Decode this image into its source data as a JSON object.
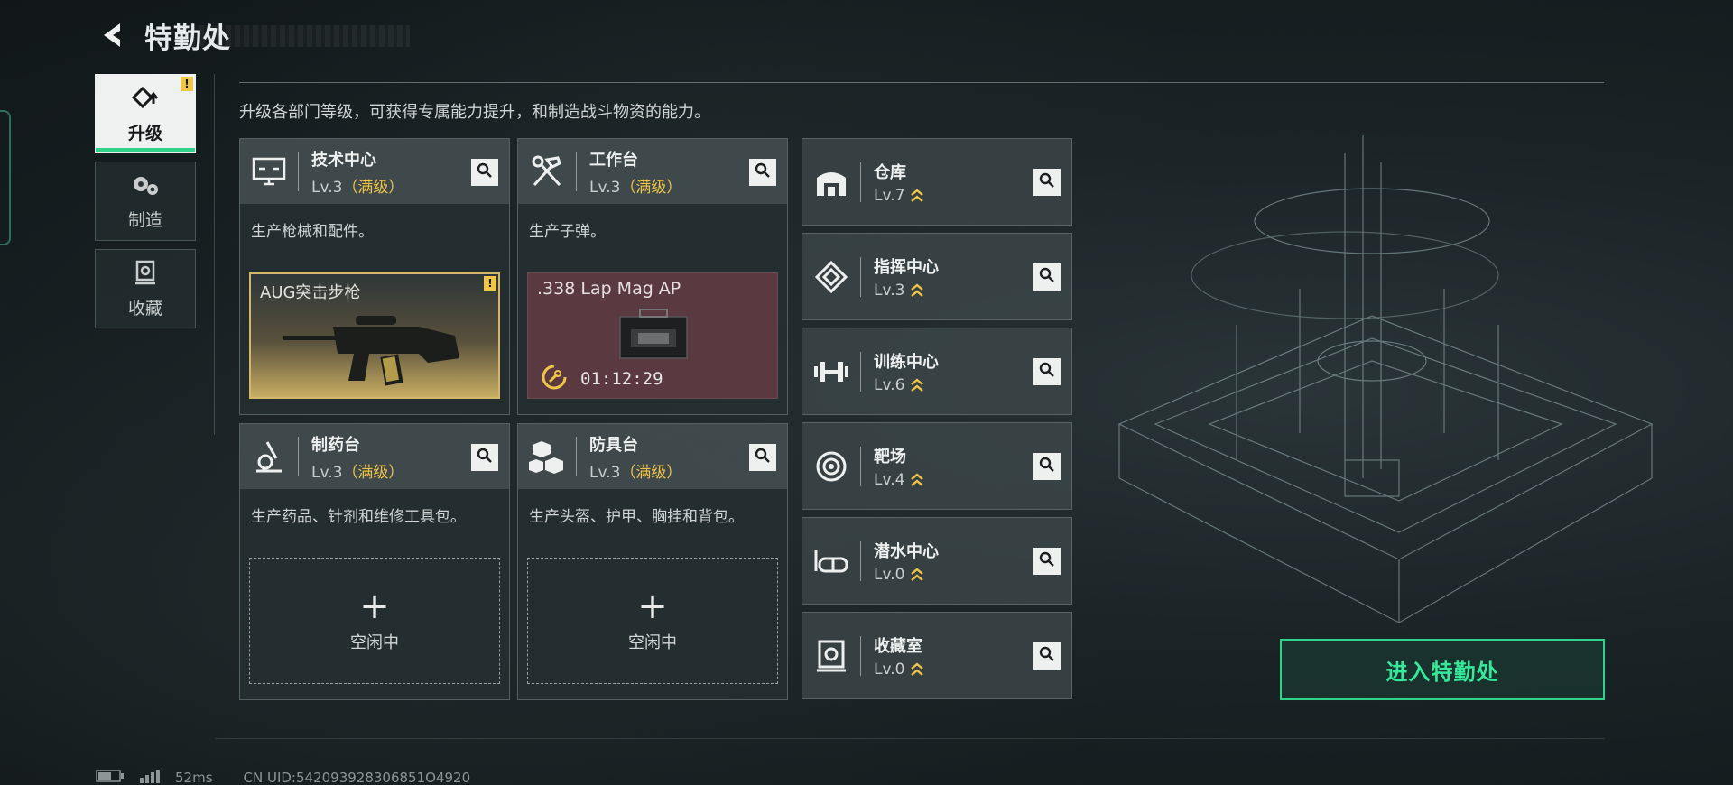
{
  "header": {
    "title": "特勤处"
  },
  "side_nav": [
    {
      "label": "升级",
      "icon": "upgrade-icon",
      "active": true,
      "badge": "!"
    },
    {
      "label": "制造",
      "icon": "gears-icon",
      "active": false
    },
    {
      "label": "收藏",
      "icon": "collection-icon",
      "active": false
    }
  ],
  "intro": "升级各部门等级，可获得专属能力提升，和制造战斗物资的能力。",
  "production_cards": [
    {
      "name": "技术中心",
      "level": "Lv.3",
      "maxed": "（满级）",
      "desc": "生产枪械和配件。",
      "icon": "monitor-icon",
      "slot": {
        "type": "weapon",
        "label": "AUG突击步枪",
        "badge": "!"
      }
    },
    {
      "name": "工作台",
      "level": "Lv.3",
      "maxed": "（满级）",
      "desc": "生产子弹。",
      "icon": "tools-icon",
      "slot": {
        "type": "ammo",
        "label": ".338 Lap Mag AP",
        "timer": "01:12:29"
      }
    },
    {
      "name": "制药台",
      "level": "Lv.3",
      "maxed": "（满级）",
      "desc": "生产药品、针剂和维修工具包。",
      "icon": "microscope-icon",
      "slot": {
        "type": "idle",
        "label": "空闲中"
      }
    },
    {
      "name": "防具台",
      "level": "Lv.3",
      "maxed": "（满级）",
      "desc": "生产头盔、护甲、胸挂和背包。",
      "icon": "armor-icon",
      "slot": {
        "type": "idle",
        "label": "空闲中"
      }
    }
  ],
  "departments": [
    {
      "name": "仓库",
      "level": "Lv.7",
      "icon": "warehouse-icon"
    },
    {
      "name": "指挥中心",
      "level": "Lv.3",
      "icon": "command-icon"
    },
    {
      "name": "训练中心",
      "level": "Lv.6",
      "icon": "dumbbell-icon"
    },
    {
      "name": "靶场",
      "level": "Lv.4",
      "icon": "target-icon"
    },
    {
      "name": "潜水中心",
      "level": "Lv.0",
      "icon": "diving-mask-icon"
    },
    {
      "name": "收藏室",
      "level": "Lv.0",
      "icon": "vault-icon"
    }
  ],
  "enter_button": "进入特勤处",
  "footer": {
    "ping": "52ms",
    "uid": "CN UID:542093928306851O4920"
  },
  "colors": {
    "accent": "#2fd38a",
    "gold": "#f0c64a",
    "ammo_bg": "#5a3a40"
  }
}
